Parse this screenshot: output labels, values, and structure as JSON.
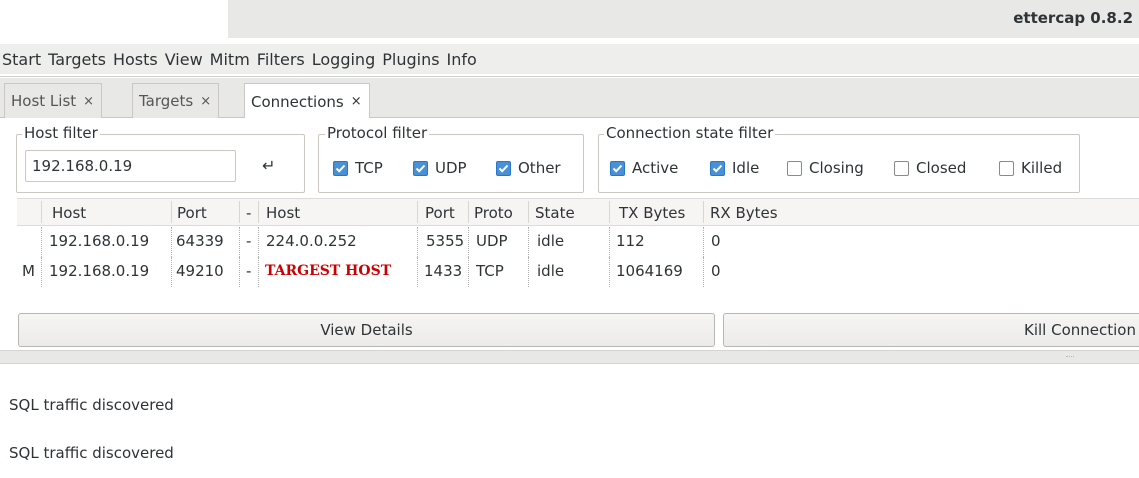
{
  "window": {
    "title": "ettercap 0.8.2"
  },
  "menubar": {
    "items": [
      "Start",
      "Targets",
      "Hosts",
      "View",
      "Mitm",
      "Filters",
      "Logging",
      "Plugins",
      "Info"
    ]
  },
  "tabs": [
    {
      "label": "Host List",
      "close": "×"
    },
    {
      "label": "Targets",
      "close": "×"
    },
    {
      "label": "Connections",
      "close": "×"
    }
  ],
  "host_filter": {
    "label": "Host filter",
    "value": "192.168.0.19",
    "enter_icon": "↵"
  },
  "protocol_filter": {
    "label": "Protocol filter",
    "options": [
      {
        "label": "TCP",
        "checked": true
      },
      {
        "label": "UDP",
        "checked": true
      },
      {
        "label": "Other",
        "checked": true
      }
    ]
  },
  "state_filter": {
    "label": "Connection state filter",
    "options": [
      {
        "label": "Active",
        "checked": true
      },
      {
        "label": "Idle",
        "checked": true
      },
      {
        "label": "Closing",
        "checked": false
      },
      {
        "label": "Closed",
        "checked": false
      },
      {
        "label": "Killed",
        "checked": false
      }
    ]
  },
  "table": {
    "headers": [
      "",
      "Host",
      "Port",
      "-",
      "Host",
      "Port",
      "Proto",
      "State",
      "TX Bytes",
      "RX Bytes"
    ],
    "rows": [
      {
        "flag": "",
        "src_host": "192.168.0.19",
        "src_port": "64339",
        "dir": "-",
        "dst_host": "224.0.0.252",
        "dst_port": "5355",
        "proto": "UDP",
        "state": "idle",
        "tx": "112",
        "rx": "0"
      },
      {
        "flag": "M",
        "src_host": "192.168.0.19",
        "src_port": "49210",
        "dir": "-",
        "dst_host": "TARGEST HOST",
        "dst_port": "1433",
        "proto": "TCP",
        "state": "idle",
        "tx": "1064169",
        "rx": "0"
      }
    ]
  },
  "buttons": {
    "view_details": "View Details",
    "kill_connection": "Kill Connection"
  },
  "log": {
    "lines": [
      "SQL traffic discovered",
      "SQL traffic discovered"
    ]
  },
  "colors": {
    "checkbox_checked": "#4a90d9",
    "target_text": "#cc0000"
  }
}
